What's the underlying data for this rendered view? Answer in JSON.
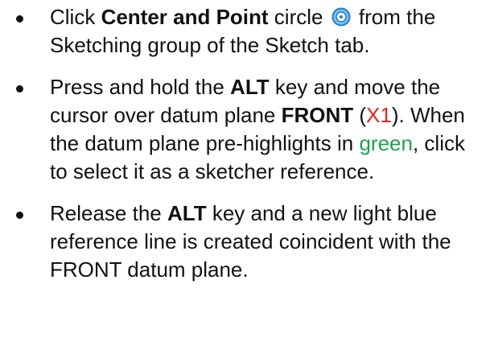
{
  "colors": {
    "text": "#111111",
    "highlight_red": "#e8221f",
    "highlight_green": "#22a14a",
    "icon_blue": "#2b8fd8"
  },
  "steps": [
    {
      "a": "Click ",
      "b": "Center and Point",
      "c": " circle ",
      "icon": "center-point-circle-icon",
      "d": " from the Sketching group of the Sketch tab."
    },
    {
      "a": "Press and hold the ",
      "b": "ALT",
      "c": " key and move the cursor over datum plane ",
      "d": "FRONT",
      "e": " (",
      "f": "X1",
      "g": "). When the datum plane pre-highlights in ",
      "h": "green",
      "i": ", click to select it as a sketcher reference."
    },
    {
      "a": "Release the ",
      "b": "ALT",
      "c": " key and a new light blue reference line is created coincident with the FRONT datum plane."
    }
  ]
}
